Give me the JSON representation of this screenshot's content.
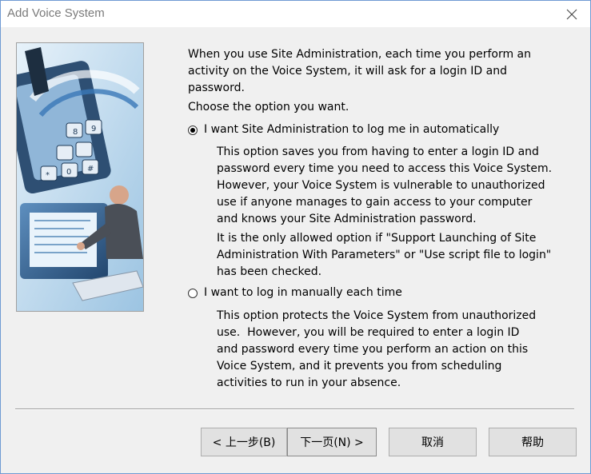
{
  "window": {
    "title": "Add Voice System"
  },
  "main": {
    "intro_lines": [
      "When you use Site Administration, each time you perform an",
      "activity on the Voice System, it will ask for a login ID and",
      "password."
    ],
    "choose": "Choose the option you want.",
    "option_auto": {
      "label": "I want Site Administration to log me in automatically",
      "selected": true,
      "desc_lines": [
        "This option saves you from having to enter a login ID and",
        "password every time you need to access this Voice System.",
        "However, your Voice System is vulnerable to unauthorized",
        "use if anyone manages to gain access to your computer",
        "and knows your Site Administration password."
      ],
      "note_lines": [
        "It is the only allowed option if \"Support Launching of Site",
        "Administration With Parameters\" or \"Use script file to login\"",
        "has been checked."
      ]
    },
    "option_manual": {
      "label": "I want to log in manually each time",
      "selected": false,
      "desc_lines": [
        "This option protects the Voice System from unauthorized",
        "use.  However, you will be required to enter a login ID",
        "and password every time you perform an action on this",
        "Voice System, and it prevents you from scheduling",
        "activities to run in your absence."
      ]
    }
  },
  "buttons": {
    "back": "< 上一步(B)",
    "next": "下一页(N) >",
    "cancel": "取消",
    "help": "帮助"
  },
  "icons": {
    "close": "close-icon",
    "illustration": "wizard-illustration"
  },
  "colors": {
    "title_text": "#7a7a7a",
    "window_border": "#6f9ad3",
    "dialog_bg": "#f0f0f0",
    "button_bg": "#e1e1e1"
  }
}
